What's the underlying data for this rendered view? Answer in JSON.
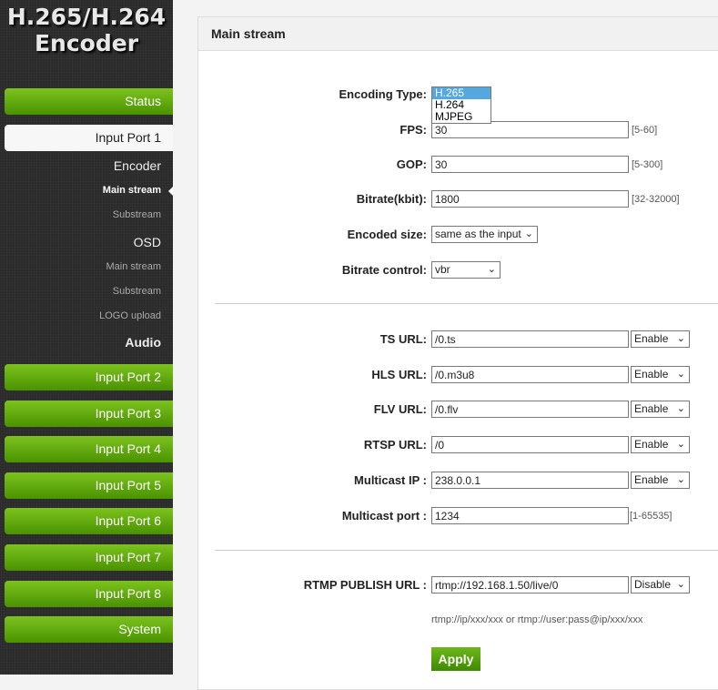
{
  "logo": {
    "line1": "H.265/H.264",
    "line2": "Encoder"
  },
  "sidebar": {
    "status": "Status",
    "input1": "Input Port 1",
    "encoder": "Encoder",
    "enc_main": "Main stream",
    "enc_sub": "Substream",
    "osd": "OSD",
    "osd_main": "Main stream",
    "osd_sub": "Substream",
    "logo_upload": "LOGO upload",
    "audio": "Audio",
    "ports": [
      "Input Port 2",
      "Input Port 3",
      "Input Port 4",
      "Input Port 5",
      "Input Port 6",
      "Input Port 7",
      "Input Port 8"
    ],
    "system": "System"
  },
  "panel": {
    "title": "Main stream"
  },
  "form": {
    "encoding_type": {
      "label": "Encoding Type:",
      "options": [
        "H.265",
        "H.264",
        "MJPEG"
      ],
      "selected": "H.265"
    },
    "fps": {
      "label": "FPS:",
      "value": "30",
      "range": "[5-60]"
    },
    "gop": {
      "label": "GOP:",
      "value": "30",
      "range": "[5-300]"
    },
    "bitrate": {
      "label": "Bitrate(kbit):",
      "value": "1800",
      "range": "[32-32000]"
    },
    "encoded_size": {
      "label": "Encoded size:",
      "value": "same as the input"
    },
    "bitrate_control": {
      "label": "Bitrate control:",
      "value": "vbr"
    },
    "ts": {
      "label": "TS URL:",
      "value": "/0.ts",
      "state": "Enable"
    },
    "hls": {
      "label": "HLS URL:",
      "value": "/0.m3u8",
      "state": "Enable"
    },
    "flv": {
      "label": "FLV URL:",
      "value": "/0.flv",
      "state": "Enable"
    },
    "rtsp": {
      "label": "RTSP URL:",
      "value": "/0",
      "state": "Enable"
    },
    "mcast_ip": {
      "label": "Multicast IP :",
      "value": "238.0.0.1",
      "state": "Enable"
    },
    "mcast_port": {
      "label": "Multicast port :",
      "value": "1234",
      "range": "[1-65535]"
    },
    "rtmp": {
      "label": "RTMP PUBLISH URL :",
      "value": "rtmp://192.168.1.50/live/0",
      "state": "Disable",
      "hint": "rtmp://ip/xxx/xxx or rtmp://user:pass@ip/xxx/xxx"
    },
    "apply": "Apply"
  }
}
